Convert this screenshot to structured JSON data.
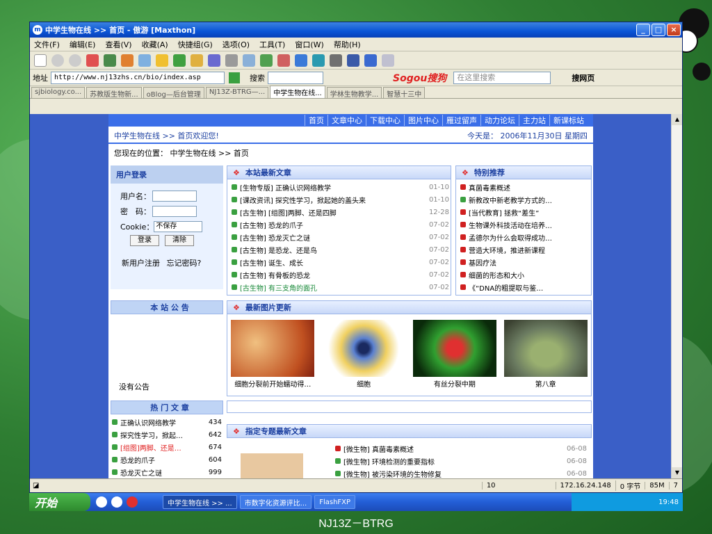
{
  "window": {
    "title": "中学生物在线 >> 首页 - 傲游 [Maxthon]",
    "menu": [
      "文件(F)",
      "编辑(E)",
      "查看(V)",
      "收藏(A)",
      "快捷组(G)",
      "选项(O)",
      "工具(T)",
      "窗口(W)",
      "帮助(H)"
    ]
  },
  "address": {
    "label": "地址",
    "url": "http://www.nj13zhs.cn/bio/index.asp",
    "search_label": "搜索",
    "sogou_logo": "Sogou搜狗",
    "sogou_placeholder": "在这里搜索",
    "sogou_button": "搜网页"
  },
  "tabs": [
    "sjbiology.co...",
    "苏教版生物新...",
    "oBlog—后台管理",
    "NJ13Z-BTRG—...",
    "中学生物在线...",
    "学林生物教学...",
    "智慧十三中"
  ],
  "page": {
    "nav": [
      "首页",
      "文章中心",
      "下载中心",
      "图片中心",
      "雁过留声",
      "动力论坛",
      "主力站",
      "新课标站"
    ],
    "welcome": "中学生物在线 >> 首页欢迎您!",
    "today": "今天是： 2006年11月30日 星期四",
    "location": "您现在的位置： 中学生物在线 >> 首页",
    "login": {
      "title": "用户登录",
      "user_label": "用户名：",
      "pass_label": "密　码：",
      "cookie_label": "Cookie：",
      "cookie_value": "不保存",
      "login_btn": "登录",
      "clear_btn": "清除",
      "register": "新用户注册",
      "forgot": "忘记密码?"
    },
    "latest_title": "本站最新文章",
    "latest": [
      {
        "title": "[生物专版] 正确认识网络教学",
        "date": "01-10"
      },
      {
        "title": "[课改资讯] 探究性学习，掀起她的盖头来",
        "date": "01-10"
      },
      {
        "title": "[古生物] [组图]两脚、还是四脚",
        "date": "12-28"
      },
      {
        "title": "[古生物] 恐龙的爪子",
        "date": "07-02"
      },
      {
        "title": "[古生物] 恐龙灭亡之谜",
        "date": "07-02"
      },
      {
        "title": "[古生物] 是恐龙、还是鸟",
        "date": "07-02"
      },
      {
        "title": "[古生物] 诞生、成长",
        "date": "07-02"
      },
      {
        "title": "[古生物] 有骨板的恐龙",
        "date": "07-02"
      },
      {
        "title": "[古生物] 有三支角的面孔",
        "date": "07-02"
      }
    ],
    "featured_title": "特别推荐",
    "featured": [
      "真菌毒素概述",
      "新教改中新老教学方式的…",
      "[当代教育] 拯救“差生”",
      "生物课外科技活动在培养…",
      "孟德尔为什么会取得成功…",
      "营造大环境，推进新课程",
      "基因疗法",
      "细菌的形态和大小",
      "《“DNA的粗提取与鉴…"
    ],
    "notice_title": "本 站 公 告",
    "notice_text": "没有公告",
    "pics_title": "最新图片更新",
    "pics": [
      "细胞分裂前开始蠕动得…",
      "细胞",
      "有丝分裂中期",
      "第八章"
    ],
    "hot_title": "热 门 文 章",
    "hot": [
      {
        "title": "正确认识网络教学",
        "count": "434"
      },
      {
        "title": "探究性学习，掀起…",
        "count": "642"
      },
      {
        "title": "[组图]两脚、还是…",
        "count": "674"
      },
      {
        "title": "恐龙的爪子",
        "count": "604"
      },
      {
        "title": "恐龙灭亡之谜",
        "count": "999"
      }
    ],
    "special_title": "指定专题最新文章",
    "special": [
      {
        "title": "[微生物] 真菌毒素概述",
        "date": "06-08"
      },
      {
        "title": "[微生物] 环境检测的重要指标",
        "date": "06-08"
      },
      {
        "title": "[微生物] 被污染环境的生物修复",
        "date": "06-08"
      }
    ]
  },
  "status": {
    "count": "10",
    "ip": "172.16.24.148",
    "bytes": "0 字节",
    "mem": "85M",
    "num": "7"
  },
  "taskbar": {
    "start": "开始",
    "tasks": [
      "中学生物在线 >> ...",
      "市数字化资源评比...",
      "FlashFXP"
    ],
    "clock": "19:48"
  },
  "caption": "NJ13Z－BTRG"
}
